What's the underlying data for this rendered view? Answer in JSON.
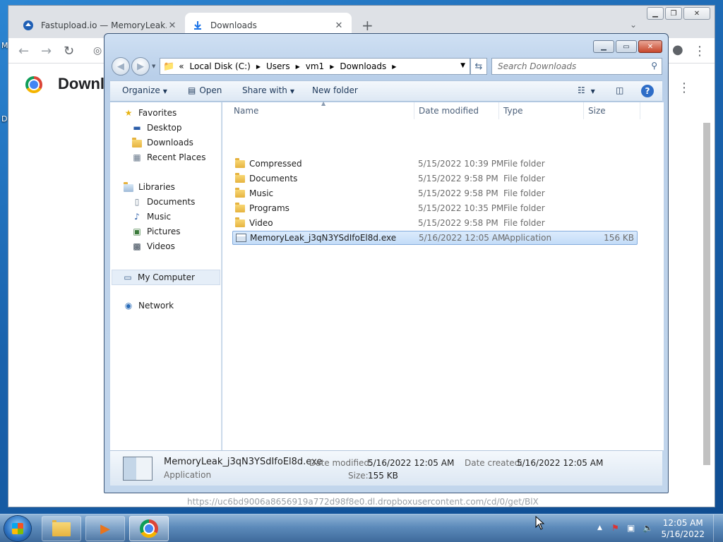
{
  "browser": {
    "tabs": [
      {
        "title": "Fastupload.io — MemoryLeak.exe",
        "active": false,
        "icon": "fastupload-icon"
      },
      {
        "title": "Downloads",
        "active": true,
        "icon": "download-arrow-icon"
      }
    ],
    "new_tab_label": "+",
    "page_heading": "Downlo",
    "download_url": "https://uc6bd9006a8656919a772d98f8e0.dl.dropboxusercontent.com/cd/0/get/BlX"
  },
  "explorer": {
    "address": {
      "overflow": "«",
      "crumbs": [
        "Local Disk (C:)",
        "Users",
        "vm1",
        "Downloads"
      ]
    },
    "search_placeholder": "Search Downloads",
    "commands": {
      "organize": "Organize",
      "open": "Open",
      "share_with": "Share with",
      "new_folder": "New folder"
    },
    "nav": {
      "favorites": "Favorites",
      "desktop": "Desktop",
      "downloads": "Downloads",
      "recent_places": "Recent Places",
      "libraries": "Libraries",
      "documents": "Documents",
      "music": "Music",
      "pictures": "Pictures",
      "videos": "Videos",
      "my_computer": "My Computer",
      "network": "Network"
    },
    "columns": {
      "name": "Name",
      "date": "Date modified",
      "type": "Type",
      "size": "Size"
    },
    "files": [
      {
        "name": "Compressed",
        "date": "5/15/2022 10:39 PM",
        "type": "File folder",
        "size": "",
        "kind": "folder"
      },
      {
        "name": "Documents",
        "date": "5/15/2022 9:58 PM",
        "type": "File folder",
        "size": "",
        "kind": "folder"
      },
      {
        "name": "Music",
        "date": "5/15/2022 9:58 PM",
        "type": "File folder",
        "size": "",
        "kind": "folder"
      },
      {
        "name": "Programs",
        "date": "5/15/2022 10:35 PM",
        "type": "File folder",
        "size": "",
        "kind": "folder"
      },
      {
        "name": "Video",
        "date": "5/15/2022 9:58 PM",
        "type": "File folder",
        "size": "",
        "kind": "folder"
      },
      {
        "name": "MemoryLeak_j3qN3YSdIfoEl8d.exe",
        "date": "5/16/2022 12:05 AM",
        "type": "Application",
        "size": "156 KB",
        "kind": "app"
      }
    ],
    "details": {
      "name": "MemoryLeak_j3qN3YSdIfoEl8d.exe",
      "type": "Application",
      "date_modified_label": "Date modified:",
      "date_modified": "5/16/2022 12:05 AM",
      "date_created_label": "Date created:",
      "date_created": "5/16/2022 12:05 AM",
      "size_label": "Size:",
      "size": "155 KB"
    }
  },
  "taskbar": {
    "clock_time": "12:05 AM",
    "clock_date": "5/16/2022"
  },
  "colors": {
    "selection": "#c3dcf8",
    "explorer_frame": "#b9cfe9",
    "taskbar": "#5d8bbb"
  }
}
